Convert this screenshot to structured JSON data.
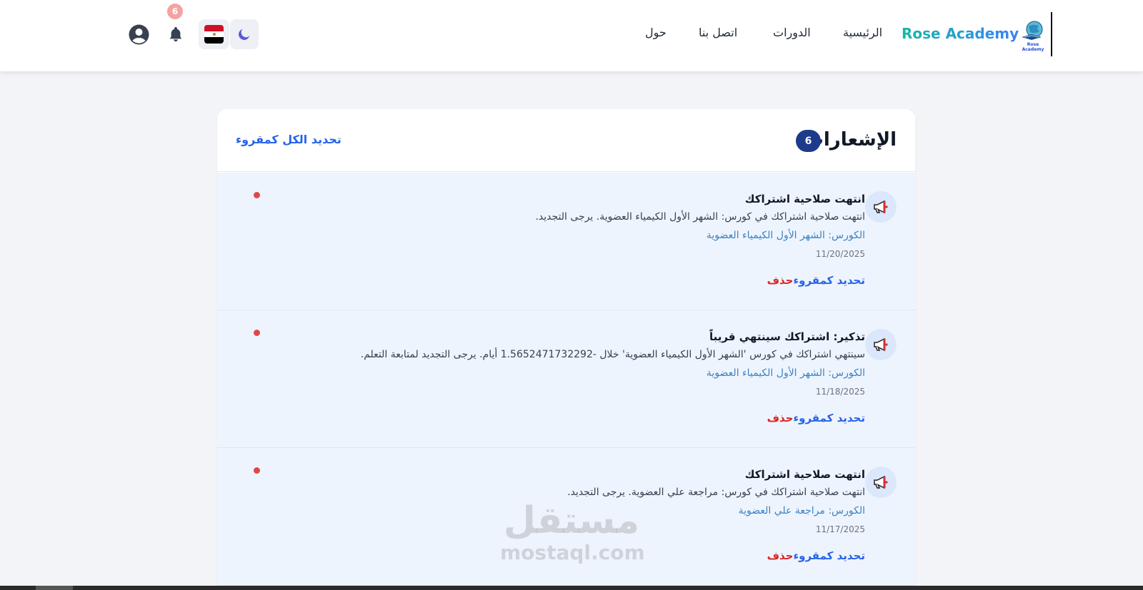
{
  "header": {
    "brand": "Rose Academy",
    "logo_caption": "Rose Academy",
    "nav": {
      "home": "الرئيسية",
      "courses": "الدورات",
      "contact": "اتصل بنا",
      "about": "حول"
    },
    "notification_count": "6",
    "colors": {
      "brand_start": "#14b8a6",
      "brand_end": "#3b82f6"
    }
  },
  "notifications": {
    "title": "الإشعارات",
    "count": "6",
    "mark_all_label": "تحديد الكل كمقروء",
    "items": [
      {
        "title": "انتهت صلاحية اشتراكك",
        "message": "انتهت صلاحية اشتراكك في كورس: الشهر الأول الكيمياء العضوية. يرجى التجديد.",
        "course": "الكورس: الشهر الأول الكيمياء العضوية",
        "date": "11/20/2025",
        "mark_label": "تحديد كمقروء",
        "delete_label": "حذف"
      },
      {
        "title": "تذكير: اشتراكك سينتهي قريباً",
        "message": "سينتهي اشتراكك في كورس 'الشهر الأول الكيمياء العضوية' خلال -1.5652471732292 أيام. يرجى التجديد لمتابعة التعلم.",
        "course": "الكورس: الشهر الأول الكيمياء العضوية",
        "date": "11/18/2025",
        "mark_label": "تحديد كمقروء",
        "delete_label": "حذف"
      },
      {
        "title": "انتهت صلاحية اشتراكك",
        "message": "انتهت صلاحية اشتراكك في كورس: مراجعة علي العضوية. يرجى التجديد.",
        "course": "الكورس: مراجعة علي العضوية",
        "date": "11/17/2025",
        "mark_label": "تحديد كمقروء",
        "delete_label": "حذف"
      }
    ]
  },
  "watermark": {
    "arabic": "مستقل",
    "latin": "mostaql.com"
  }
}
